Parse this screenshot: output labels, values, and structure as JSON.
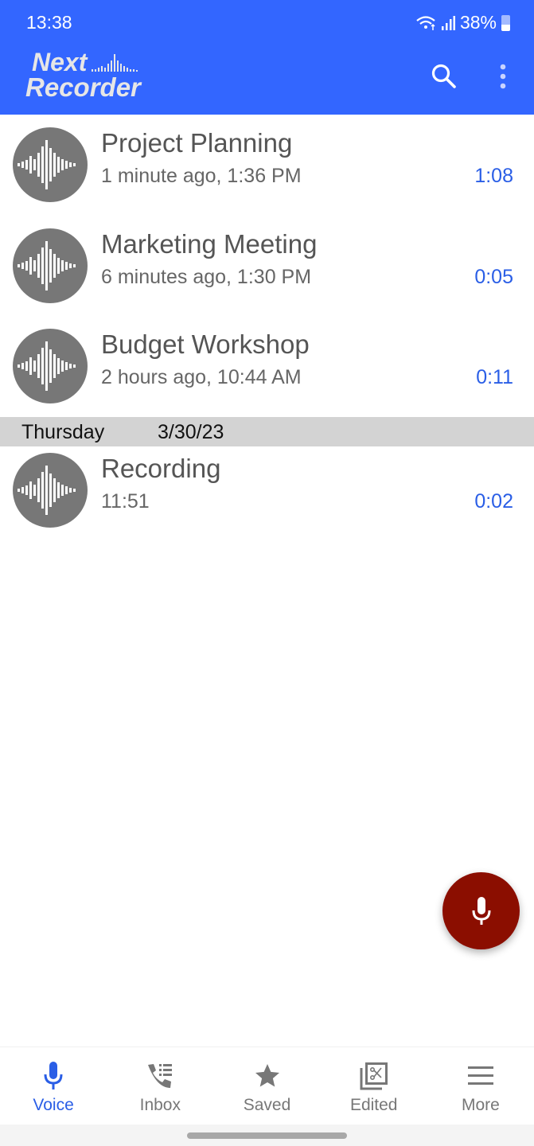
{
  "status_bar": {
    "time": "13:38",
    "battery": "38%"
  },
  "app_bar": {
    "logo_line1": "Next",
    "logo_line2": "Recorder",
    "search_icon": "search-icon",
    "more_icon": "more-vert-icon"
  },
  "colors": {
    "primary": "#3366ff",
    "accent_text": "#2a5ee6",
    "fab": "#8b0e00",
    "avatar": "#777777",
    "section": "#d3d3d3"
  },
  "recordings": [
    {
      "title": "Project Planning",
      "subtitle": "1 minute ago, 1:36 PM",
      "duration": "1:08"
    },
    {
      "title": "Marketing Meeting",
      "subtitle": "6 minutes ago, 1:30 PM",
      "duration": "0:05"
    },
    {
      "title": "Budget Workshop",
      "subtitle": "2 hours ago, 10:44 AM",
      "duration": "0:11"
    }
  ],
  "section": {
    "day": "Thursday",
    "date": "3/30/23"
  },
  "older_recordings": [
    {
      "title": "Recording",
      "subtitle": "11:51",
      "duration": "0:02"
    }
  ],
  "fab": {
    "icon": "mic-icon"
  },
  "bottom_nav": [
    {
      "label": "Voice",
      "icon": "mic-icon",
      "active": true
    },
    {
      "label": "Inbox",
      "icon": "phone-list-icon",
      "active": false
    },
    {
      "label": "Saved",
      "icon": "star-icon",
      "active": false
    },
    {
      "label": "Edited",
      "icon": "scissors-copy-icon",
      "active": false
    },
    {
      "label": "More",
      "icon": "menu-icon",
      "active": false
    }
  ]
}
